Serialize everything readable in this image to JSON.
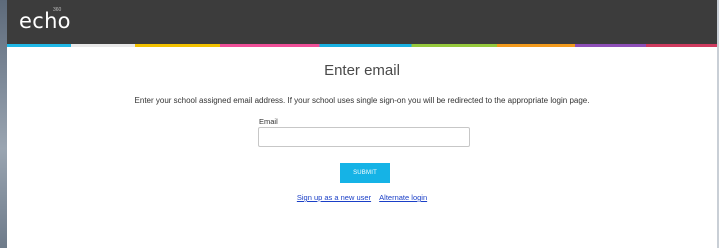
{
  "header": {
    "logo_text": "echo",
    "logo_sup": "360"
  },
  "colors": {
    "topbar": "#3c3c3c",
    "accent": "#15b3e6",
    "link": "#1a3fc7"
  },
  "form": {
    "title": "Enter email",
    "instructions": "Enter your school assigned email address. If your school uses single sign-on you will be redirected to the appropriate login page.",
    "email_label": "Email",
    "email_value": "",
    "email_placeholder": "",
    "submit_label": "SUBMIT"
  },
  "links": {
    "signup": "Sign up as a new user",
    "alternate": "Alternate login"
  }
}
